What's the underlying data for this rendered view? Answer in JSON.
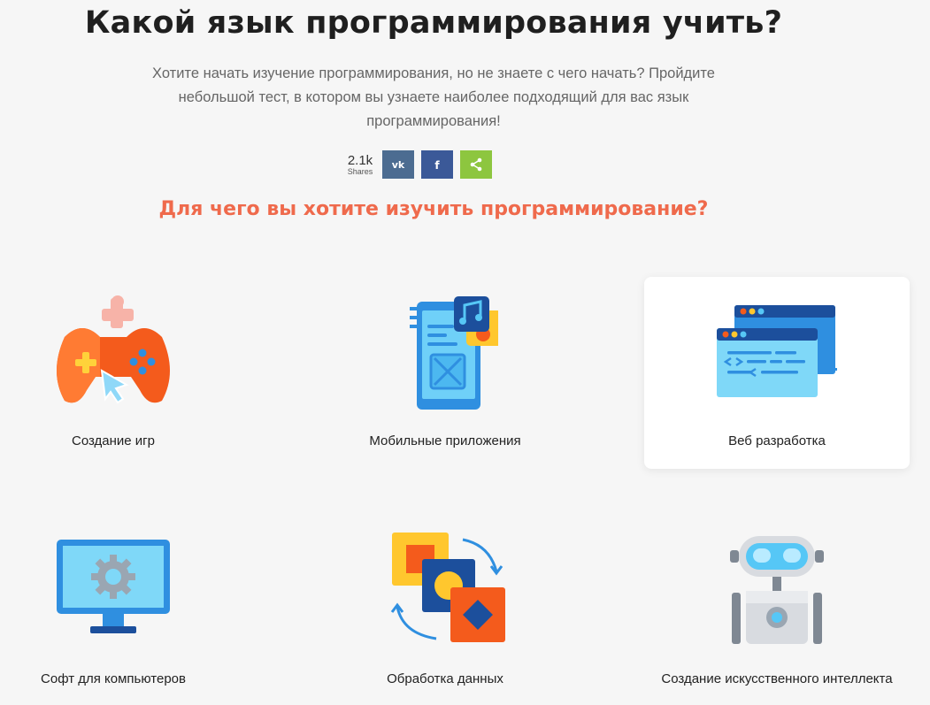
{
  "header": {
    "title": "Какой язык программирования учить?",
    "subtitle": "Хотите начать изучение программирования, но не знаете с чего начать? Пройдите небольшой тест, в котором вы узнаете наиболее подходящий для вас язык программирования!"
  },
  "shares": {
    "count": "2.1k",
    "label": "Shares",
    "buttons": [
      {
        "name": "vk",
        "label": "vk",
        "color": "#4c6c91"
      },
      {
        "name": "facebook",
        "label": "f",
        "color": "#3b5998"
      },
      {
        "name": "share",
        "label": "share",
        "color": "#8dc63f"
      }
    ]
  },
  "question": "Для чего вы хотите изучить программирование?",
  "question_color": "#ef6a4c",
  "options": [
    {
      "label": "Создание игр",
      "icon": "gamepad-icon",
      "selected": false
    },
    {
      "label": "Мобильные приложения",
      "icon": "mobile-app-icon",
      "selected": false
    },
    {
      "label": "Веб разработка",
      "icon": "web-dev-icon",
      "selected": true
    },
    {
      "label": "Софт для компьютеров",
      "icon": "monitor-gear-icon",
      "selected": false
    },
    {
      "label": "Обработка данных",
      "icon": "data-processing-icon",
      "selected": false
    },
    {
      "label": "Создание искусственного интеллекта",
      "icon": "robot-icon",
      "selected": false
    }
  ]
}
